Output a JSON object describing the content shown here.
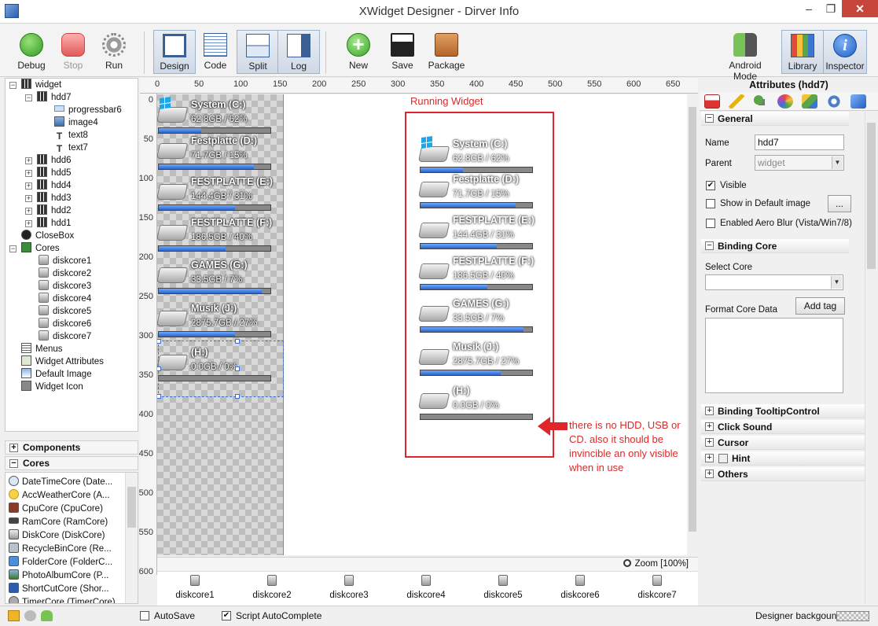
{
  "window": {
    "title": "XWidget Designer - Dirver Info",
    "min": "–",
    "max": "❐",
    "close": "✕"
  },
  "toolbar": {
    "debug": "Debug",
    "stop": "Stop",
    "run": "Run",
    "design": "Design",
    "code": "Code",
    "split": "Split",
    "log": "Log",
    "new": "New",
    "save": "Save",
    "package": "Package",
    "android_mode": "Android Mode",
    "library": "Library",
    "inspector": "Inspector"
  },
  "tree": {
    "nodes": [
      {
        "label": "widget"
      },
      {
        "label": "hdd7"
      },
      {
        "label": "progressbar6"
      },
      {
        "label": "image4"
      },
      {
        "label": "text8"
      },
      {
        "label": "text7"
      },
      {
        "label": "hdd6"
      },
      {
        "label": "hdd5"
      },
      {
        "label": "hdd4"
      },
      {
        "label": "hdd3"
      },
      {
        "label": "hdd2"
      },
      {
        "label": "hdd1"
      },
      {
        "label": "CloseBox"
      },
      {
        "label": "Cores"
      },
      {
        "label": "diskcore1"
      },
      {
        "label": "diskcore2"
      },
      {
        "label": "diskcore3"
      },
      {
        "label": "diskcore4"
      },
      {
        "label": "diskcore5"
      },
      {
        "label": "diskcore6"
      },
      {
        "label": "diskcore7"
      },
      {
        "label": "Menus"
      },
      {
        "label": "Widget Attributes"
      },
      {
        "label": "Default Image"
      },
      {
        "label": "Widget Icon"
      }
    ]
  },
  "sections": {
    "components": "Components",
    "cores": "Cores"
  },
  "cores_list": [
    {
      "label": "DateTimeCore (Date..."
    },
    {
      "label": "AccWeatherCore (A..."
    },
    {
      "label": "CpuCore (CpuCore)"
    },
    {
      "label": "RamCore (RamCore)"
    },
    {
      "label": "DiskCore (DiskCore)"
    },
    {
      "label": "RecycleBinCore (Re..."
    },
    {
      "label": "FolderCore (FolderC..."
    },
    {
      "label": "PhotoAlbumCore (P..."
    },
    {
      "label": "ShortCutCore (Shor..."
    },
    {
      "label": "TimerCore (TimerCore)"
    }
  ],
  "ruler": {
    "h": [
      "0",
      "50",
      "100",
      "150",
      "200",
      "250",
      "300",
      "350",
      "400",
      "450",
      "500",
      "550",
      "600",
      "650"
    ],
    "v": [
      "0",
      "50",
      "100",
      "150",
      "200",
      "250",
      "300",
      "350",
      "400",
      "450",
      "500",
      "550",
      "600"
    ]
  },
  "drives": [
    {
      "name": "System (C:)",
      "info": "62.8GB  / 62%",
      "percent": 62
    },
    {
      "name": "Festplatte (D:)",
      "info": "71.7GB  / 15%",
      "percent": 15
    },
    {
      "name": "FESTPLATTE (E:)",
      "info": "144.4GB  / 31%",
      "percent": 31
    },
    {
      "name": "FESTPLATTE (F:)",
      "info": "186.5GB  / 40%",
      "percent": 40
    },
    {
      "name": "GAMES (G:)",
      "info": "33.5GB  / 7%",
      "percent": 7
    },
    {
      "name": "Musik (J:)",
      "info": "2875.7GB  / 27%",
      "percent": 27
    },
    {
      "name": "(H:)",
      "info": "0.0GB  / 0%",
      "percent": 0
    }
  ],
  "design_bar_fill": [
    38,
    85,
    68,
    60,
    92,
    68,
    0
  ],
  "run_bar_fill": [
    38,
    85,
    68,
    60,
    92,
    72,
    0
  ],
  "canvas": {
    "running_label": "Running Widget",
    "annotation": "there is no HDD, USB or CD. also it should be invincible an only visible when in use"
  },
  "zoom": "Zoom [100%]",
  "cores_strip": [
    "diskcore1",
    "diskcore2",
    "diskcore3",
    "diskcore4",
    "diskcore5",
    "diskcore6",
    "diskcore7"
  ],
  "inspector": {
    "title": "Attributes (hdd7)",
    "general": "General",
    "name_label": "Name",
    "name_value": "hdd7",
    "parent_label": "Parent",
    "parent_value": "widget",
    "visible": "Visible",
    "visible_checked": true,
    "show_default": "Show in Default image",
    "dots": "...",
    "aero_blur": "Enabled Aero Blur (Vista/Win7/8)",
    "binding_core": "Binding Core",
    "select_core": "Select Core",
    "format_core_data": "Format Core Data",
    "add_tag": "Add tag",
    "binding_tooltip": "Binding TooltipControl",
    "click_sound": "Click Sound",
    "cursor": "Cursor",
    "hint": "Hint",
    "others": "Others"
  },
  "statusbar": {
    "autosave": "AutoSave",
    "autosave_checked": false,
    "script_autocomplete": "Script AutoComplete",
    "script_autocomplete_checked": true,
    "designer_background": "Designer backgound"
  }
}
